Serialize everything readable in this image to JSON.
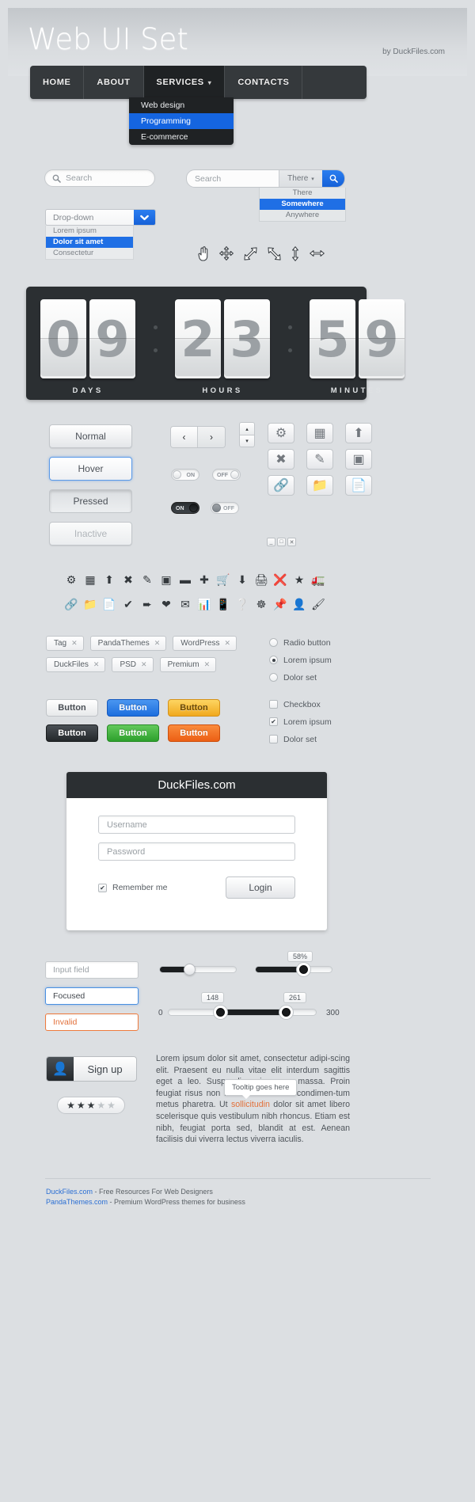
{
  "header": {
    "title": "Web UI Set",
    "by": "by DuckFiles.com"
  },
  "nav": {
    "items": [
      {
        "label": "HOME",
        "active": false
      },
      {
        "label": "ABOUT",
        "active": false
      },
      {
        "label": "SERVICES",
        "active": true,
        "caret": "chevron-down-icon"
      },
      {
        "label": "CONTACTS",
        "active": false
      }
    ],
    "dropdown": [
      {
        "label": "Web design",
        "selected": false
      },
      {
        "label": "Programming",
        "selected": true
      },
      {
        "label": "E-commerce",
        "selected": false
      }
    ]
  },
  "search": {
    "pill_placeholder": "Search",
    "bar_placeholder": "Search",
    "scope_value": "There",
    "scope_options": [
      {
        "label": "There",
        "selected": false
      },
      {
        "label": "Somewhere",
        "selected": true
      },
      {
        "label": "Anywhere",
        "selected": false
      }
    ]
  },
  "dropdown": {
    "value": "Drop-down",
    "options": [
      {
        "label": "Lorem ipsum",
        "selected": false
      },
      {
        "label": "Dolor sit amet",
        "selected": true
      },
      {
        "label": "Consectetur",
        "selected": false
      }
    ]
  },
  "cursors": [
    "pointer-hand-icon",
    "move-icon",
    "resize-ne-icon",
    "resize-se-icon",
    "resize-vertical-icon",
    "resize-horizontal-icon"
  ],
  "counter": {
    "groups": [
      {
        "label": "DAYS",
        "digits": [
          "0",
          "9"
        ]
      },
      {
        "label": "HOURS",
        "digits": [
          "2",
          "3"
        ]
      },
      {
        "label": "MINUTES",
        "digits": [
          "5",
          "9"
        ]
      }
    ]
  },
  "button_states": [
    {
      "label": "Normal",
      "state": "normal"
    },
    {
      "label": "Hover",
      "state": "hover"
    },
    {
      "label": "Pressed",
      "state": "pressed"
    },
    {
      "label": "Inactive",
      "state": "inactive"
    }
  ],
  "prevnext": {
    "prev": "‹",
    "next": "›"
  },
  "spinner": {
    "up": "▴",
    "down": "▾"
  },
  "toggles": [
    {
      "style": "light",
      "state": "on",
      "label": "ON"
    },
    {
      "style": "light",
      "state": "off",
      "label": "OFF"
    },
    {
      "style": "dark",
      "state": "on",
      "label": "ON"
    },
    {
      "style": "dark",
      "state": "off",
      "label": "OFF"
    }
  ],
  "square_buttons": [
    "gears-icon",
    "window-icon",
    "upload-icon",
    "close-x-icon",
    "pencil-icon",
    "box-icon",
    "link-icon",
    "folder-icon",
    "document-icon"
  ],
  "window_controls": [
    "minimize-icon",
    "maximize-icon",
    "close-icon"
  ],
  "icon_row_1": [
    "gears-icon",
    "window-icon",
    "upload-icon",
    "close-x-icon",
    "pencil-icon",
    "box-icon",
    "minus-icon",
    "plus-icon",
    "cart-icon",
    "download-icon",
    "printer-icon",
    "cancel-circle-icon",
    "star-icon",
    "truck-icon"
  ],
  "icon_row_2": [
    "link-icon",
    "folder-icon",
    "document-icon",
    "check-icon",
    "plane-icon",
    "heart-icon",
    "mail-icon",
    "chart-icon",
    "mobile-icon",
    "help-icon",
    "lifebuoy-icon",
    "pushpin-icon",
    "user-tie-icon",
    "brush-icon"
  ],
  "tags": [
    [
      "Tag",
      "PandaThemes",
      "WordPress"
    ],
    [
      "DuckFiles",
      "PSD",
      "Premium"
    ]
  ],
  "radios": [
    {
      "label": "Radio button",
      "selected": false
    },
    {
      "label": "Lorem ipsum",
      "selected": true
    },
    {
      "label": "Dolor set",
      "selected": false
    }
  ],
  "checkboxes": [
    {
      "label": "Checkbox",
      "checked": false
    },
    {
      "label": "Lorem ipsum",
      "checked": true
    },
    {
      "label": "Dolor set",
      "checked": false
    }
  ],
  "color_buttons": [
    [
      {
        "label": "Button",
        "color": "white"
      },
      {
        "label": "Button",
        "color": "blue"
      },
      {
        "label": "Button",
        "color": "yellow"
      }
    ],
    [
      {
        "label": "Button",
        "color": "dark"
      },
      {
        "label": "Button",
        "color": "green"
      },
      {
        "label": "Button",
        "color": "orange"
      }
    ]
  ],
  "login": {
    "title": "DuckFiles.com",
    "username_placeholder": "Username",
    "password_placeholder": "Password",
    "remember_label": "Remember me",
    "remember_checked": true,
    "login_label": "Login"
  },
  "input_states": [
    {
      "label": "Input field",
      "state": "normal"
    },
    {
      "label": "Focused",
      "state": "focused"
    },
    {
      "label": "Invalid",
      "state": "invalid"
    }
  ],
  "sliders": {
    "plain": {
      "percent": 38
    },
    "percent": {
      "value": "58%",
      "percent": 62
    },
    "range": {
      "min_label": "0",
      "max_label": "300",
      "low_value": "148",
      "high_value": "261",
      "low_percent": 34,
      "high_percent": 79
    }
  },
  "signup": {
    "label": "Sign up",
    "icon": "user-icon"
  },
  "rating": {
    "filled": 3,
    "total": 5
  },
  "paragraph": {
    "before": "Lorem ipsum dolor sit amet, consectetur adipi-scing elit. Praesent eu nulla vitae elit interdum sagittis eget a leo. Suspendisse in quam massa. Proin feugiat risus non felis condimentum condimen-tum metus pharetra. Ut ",
    "highlight": "sollicitudin",
    "after": " dolor sit amet libero scelerisque quis vestibulum nibh rhoncus. Etiam est nibh, feugiat porta sed, blandit at est. Aenean facilisis dui viverra lectus viverra iaculis."
  },
  "tooltip": {
    "text": "Tooltip goes here"
  },
  "footer": [
    {
      "link": "DuckFiles.com",
      "rest": " - Free Resources For Web Designers"
    },
    {
      "link": "PandaThemes.com",
      "rest": " - Premium WordPress themes for business"
    }
  ],
  "colors": {
    "accent_blue": "#1f6fe5",
    "dark": "#2b2f32",
    "bg": "#dcdfe2",
    "orange": "#e2703a"
  }
}
